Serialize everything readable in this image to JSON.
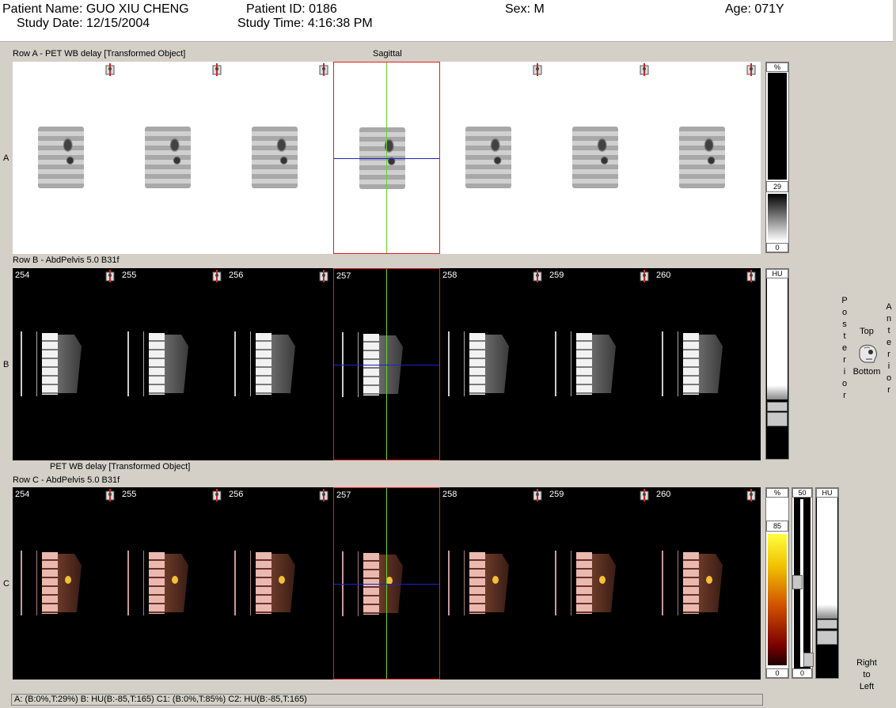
{
  "header": {
    "patient_name": "Patient Name: GUO XIU CHENG",
    "patient_id": "Patient ID: 0186",
    "sex": "Sex: M",
    "age": "Age: 071Y",
    "study_date": "Study Date: 12/15/2004",
    "study_time": "Study Time: 4:16:38 PM"
  },
  "rows": {
    "a": {
      "title": "Row A - PET WB delay [Transformed Object]",
      "view_label": "Sagittal",
      "letter": "A",
      "scale": {
        "unit": "%",
        "value": "29",
        "min": "0"
      }
    },
    "b": {
      "title": "Row B - AbdPelvis  5.0  B31f",
      "letter": "B",
      "slices": [
        "254",
        "255",
        "256",
        "257",
        "258",
        "259",
        "260"
      ],
      "scale": {
        "unit": "HU"
      }
    },
    "c": {
      "overlay_title": "PET WB delay [Transformed Object]",
      "title": "Row C - AbdPelvis  5.0  B31f",
      "letter": "C",
      "slices": [
        "254",
        "255",
        "256",
        "257",
        "258",
        "259",
        "260"
      ],
      "scale_pet": {
        "unit": "%",
        "value": "85",
        "min": "0"
      },
      "scale_blend": {
        "top": "50",
        "bottom": "0"
      },
      "scale_ct": {
        "unit": "HU"
      }
    }
  },
  "orientation": {
    "posterior": "Posterior",
    "anterior": "Anterior",
    "top": "Top",
    "bottom": "Bottom",
    "right_to_left": [
      "Right",
      "to",
      "Left"
    ],
    "icon": "head-orientation-icon"
  },
  "selected_column_index": 3,
  "status": "A: (B:0%,T:29%)    B: HU(B:-85,T:165)    C1: (B:0%,T:85%)    C2: HU(B:-85,T:165)"
}
